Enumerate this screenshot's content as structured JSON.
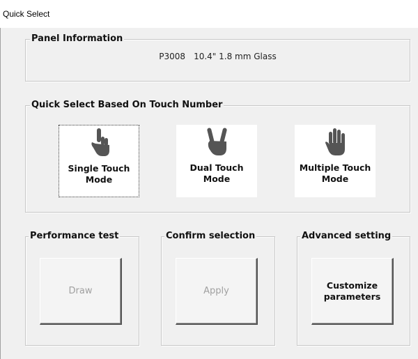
{
  "window": {
    "title": "Quick Select"
  },
  "panel_info": {
    "legend": "Panel Information",
    "model": "P3008",
    "description": "10.4\" 1.8 mm Glass"
  },
  "quick_select": {
    "legend": "Quick Select Based On Touch Number",
    "modes": [
      {
        "line1": "Single Touch",
        "line2": "Mode",
        "icon": "single-finger-hand-icon"
      },
      {
        "line1": "Dual Touch",
        "line2": "Mode",
        "icon": "two-finger-hand-icon"
      },
      {
        "line1": "Multiple Touch",
        "line2": "Mode",
        "icon": "open-hand-icon"
      }
    ]
  },
  "performance": {
    "legend": "Performance test",
    "button": "Draw"
  },
  "confirm": {
    "legend": "Confirm selection",
    "button": "Apply"
  },
  "advanced": {
    "legend": "Advanced setting",
    "line1": "Customize",
    "line2": "parameters"
  },
  "colors": {
    "window_bg": "#f0f0f0",
    "icon": "#555555",
    "disabled_text": "#a0a0a0"
  }
}
